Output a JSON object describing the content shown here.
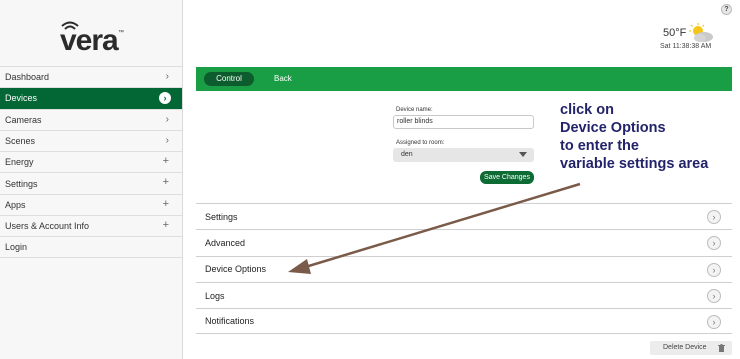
{
  "brand": {
    "logo_text": "vera",
    "logo_tm": "™"
  },
  "help_label": "?",
  "weather": {
    "temp": "50°F",
    "time": "Sat   11:38:38 AM",
    "icon": "partly-cloudy-icon"
  },
  "sidebar": {
    "items": [
      {
        "label": "Dashboard",
        "indicator": "›"
      },
      {
        "label": "Devices",
        "indicator": "›",
        "active": true
      },
      {
        "label": "Cameras",
        "indicator": "›"
      },
      {
        "label": "Scenes",
        "indicator": "›"
      },
      {
        "label": "Energy",
        "indicator": "+"
      },
      {
        "label": "Settings",
        "indicator": "+"
      },
      {
        "label": "Apps",
        "indicator": "+"
      },
      {
        "label": "Users & Account Info",
        "indicator": "+"
      },
      {
        "label": "Login",
        "indicator": ""
      }
    ]
  },
  "toolbar": {
    "control_label": "Control",
    "back_label": "Back"
  },
  "form": {
    "device_name_label": "Device name:",
    "device_name_value": "roller blinds",
    "room_label": "Assigned to room:",
    "room_value": "den",
    "save_label": "Save Changes"
  },
  "sections": [
    {
      "label": "Settings"
    },
    {
      "label": "Advanced"
    },
    {
      "label": "Device Options"
    },
    {
      "label": "Logs"
    },
    {
      "label": "Notifications"
    }
  ],
  "annotation": {
    "lines": [
      "click on",
      "Device Options",
      "to enter the",
      "variable settings area"
    ],
    "color": "#23236b",
    "arrow_color": "#7a5a48"
  },
  "delete_label": "Delete Device",
  "colors": {
    "accent_green": "#1a9e45",
    "dark_green": "#036635"
  }
}
